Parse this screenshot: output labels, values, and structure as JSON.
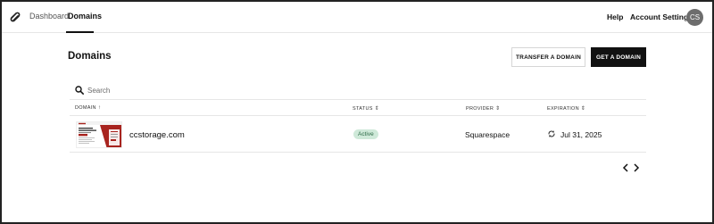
{
  "nav": {
    "logo_icon": "squarespace-logo-icon",
    "links": [
      {
        "label": "Dashboard",
        "active": false
      },
      {
        "label": "Domains",
        "active": true
      }
    ],
    "help": "Help",
    "account_settings": "Account Settings",
    "avatar_initials": "CS"
  },
  "page": {
    "title": "Domains",
    "transfer_button": "TRANSFER A DOMAIN",
    "get_button": "GET A DOMAIN"
  },
  "search": {
    "placeholder": "Search",
    "value": "",
    "icon": "search-icon"
  },
  "table": {
    "columns": [
      {
        "label": "DOMAIN",
        "sort": "↑"
      },
      {
        "label": "STATUS",
        "sort": "⇕"
      },
      {
        "label": "PROVIDER",
        "sort": "⇕"
      },
      {
        "label": "EXPIRATION",
        "sort": "⇕"
      }
    ],
    "rows": [
      {
        "domain": "ccstorage.com",
        "status": "Active",
        "provider": "Squarespace",
        "expiration": "Jul 31, 2025",
        "expiration_icon": "auto-renew-icon"
      }
    ]
  },
  "pagination": {
    "prev_icon": "chevron-left-icon",
    "next_icon": "chevron-right-icon"
  },
  "colors": {
    "primary": "#111111",
    "status_active_bg": "#cfe9d9",
    "status_active_text": "#2e6b47",
    "thumb_accent": "#a8241f"
  }
}
